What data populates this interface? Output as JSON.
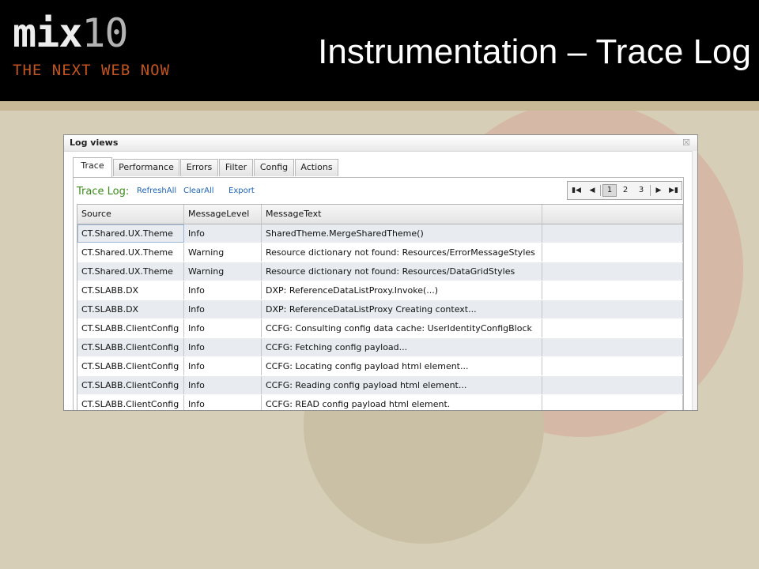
{
  "slide": {
    "logo_text": "mix",
    "logo_number": "10",
    "logo_tagline": "THE NEXT WEB NOW",
    "title": "Instrumentation – Trace Log"
  },
  "window": {
    "title": "Log views",
    "close_glyph": "☒",
    "tabs": [
      "Trace",
      "Performance",
      "Errors",
      "Filter",
      "Config",
      "Actions"
    ],
    "active_tab": "Trace"
  },
  "toolbar": {
    "label": "Trace Log:",
    "refresh_all": "RefreshAll",
    "clear_all": "ClearAll",
    "export": "Export"
  },
  "pager": {
    "first_icon": "first-page-icon",
    "prev_icon": "previous-page-icon",
    "next_icon": "next-page-icon",
    "last_icon": "last-page-icon",
    "pages": [
      "1",
      "2",
      "3"
    ],
    "current_page": "1"
  },
  "grid": {
    "columns": [
      "Source",
      "MessageLevel",
      "MessageText",
      ""
    ],
    "rows": [
      [
        "CT.Shared.UX.Theme",
        "Info",
        "SharedTheme.MergeSharedTheme()",
        ""
      ],
      [
        "CT.Shared.UX.Theme",
        "Warning",
        "Resource dictionary not found: Resources/ErrorMessageStyles",
        ""
      ],
      [
        "CT.Shared.UX.Theme",
        "Warning",
        "Resource dictionary not found: Resources/DataGridStyles",
        ""
      ],
      [
        "CT.SLABB.DX",
        "Info",
        "DXP: ReferenceDataListProxy.Invoke(...)",
        ""
      ],
      [
        "CT.SLABB.DX",
        "Info",
        "DXP: ReferenceDataListProxy Creating context...",
        ""
      ],
      [
        "CT.SLABB.ClientConfig",
        "Info",
        "CCFG: Consulting config data cache: UserIdentityConfigBlock",
        ""
      ],
      [
        "CT.SLABB.ClientConfig",
        "Info",
        "CCFG: Fetching config payload...",
        ""
      ],
      [
        "CT.SLABB.ClientConfig",
        "Info",
        "CCFG: Locating config payload html element...",
        ""
      ],
      [
        "CT.SLABB.ClientConfig",
        "Info",
        "CCFG: Reading config payload html element...",
        ""
      ],
      [
        "CT.SLABB.ClientConfig",
        "Info",
        "CCFG: READ config payload html element.",
        ""
      ]
    ]
  },
  "colors": {
    "background": "#d6ceb6",
    "banner": "#000000",
    "tagline": "#c2541f",
    "trace_label": "#3a8a1a",
    "link": "#1c63b7",
    "alt_row": "#e8ecf0"
  }
}
